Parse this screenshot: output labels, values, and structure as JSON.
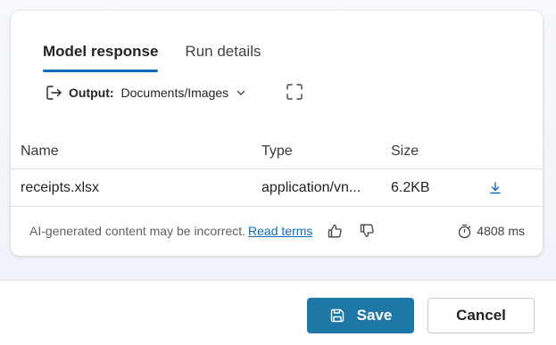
{
  "tabs": [
    {
      "label": "Model response",
      "active": true
    },
    {
      "label": "Run details",
      "active": false
    }
  ],
  "output": {
    "label": "Output:",
    "value": "Documents/Images"
  },
  "table": {
    "columns": [
      "Name",
      "Type",
      "Size"
    ],
    "rows": [
      {
        "name": "receipts.xlsx",
        "type": "application/vn...",
        "size": "6.2KB"
      }
    ]
  },
  "footer": {
    "disclaimer": "AI-generated content may be incorrect.",
    "read_terms": "Read terms",
    "duration": "4808 ms"
  },
  "buttons": {
    "save": "Save",
    "cancel": "Cancel"
  },
  "colors": {
    "accent": "#0f6cbd",
    "save_button": "#1d78a8"
  },
  "icons": [
    "export-icon",
    "chevron-down-icon",
    "expand-icon",
    "download-icon",
    "thumbs-up-icon",
    "thumbs-down-icon",
    "timer-icon",
    "save-icon"
  ]
}
